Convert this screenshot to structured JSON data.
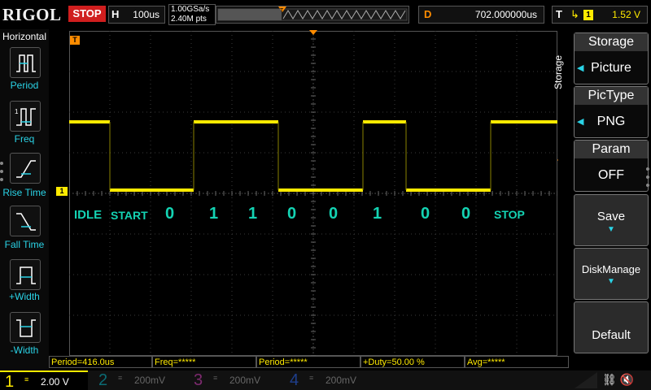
{
  "header": {
    "brand": "RIGOL",
    "run_state": "STOP",
    "horizontal": {
      "label": "H",
      "value": "100us"
    },
    "sample_rate": "1.00GSa/s",
    "memory_depth": "2.40M pts",
    "delay": {
      "label": "D",
      "value": "702.000000us"
    },
    "trigger": {
      "label": "T",
      "source": "1",
      "level": "1.52 V"
    }
  },
  "left_menu": {
    "title": "Horizontal",
    "items": [
      {
        "label": "Period"
      },
      {
        "label": "Freq"
      },
      {
        "label": "Rise Time"
      },
      {
        "label": "Fall Time"
      },
      {
        "label": "+Width"
      },
      {
        "label": "-Width"
      }
    ]
  },
  "right_menu": {
    "side_label": "Storage",
    "storage": {
      "title": "Storage",
      "value": "Picture"
    },
    "pictype": {
      "title": "PicType",
      "value": "PNG"
    },
    "param": {
      "title": "Param",
      "value": "OFF"
    },
    "save": {
      "label": "Save"
    },
    "disk": {
      "label": "DiskManage"
    },
    "default": {
      "label": "Default"
    }
  },
  "annotations": {
    "idle": "IDLE",
    "start": "START",
    "bits": [
      "0",
      "1",
      "1",
      "0",
      "0",
      "1",
      "0",
      "0"
    ],
    "stop": "STOP"
  },
  "markers": {
    "channel1": "1",
    "trigger_pos": "T"
  },
  "measurements": [
    "Period=416.0us",
    "Freq=*****",
    "Period=*****",
    "+Duty=50.00 %",
    "Avg=*****"
  ],
  "channels": [
    {
      "num": "1",
      "value": "2.00 V",
      "color": "#ffea00"
    },
    {
      "num": "2",
      "value": "200mV",
      "color": "#0b6b74"
    },
    {
      "num": "3",
      "value": "200mV",
      "color": "#7d2a6f"
    },
    {
      "num": "4",
      "value": "200mV",
      "color": "#1e3e8c"
    }
  ],
  "colors": {
    "trace": "#ffea00",
    "accent": "#2ad3e6",
    "annotation": "#14d3b3",
    "stop_bg": "#d01e1e",
    "marker": "#ff8c00"
  }
}
